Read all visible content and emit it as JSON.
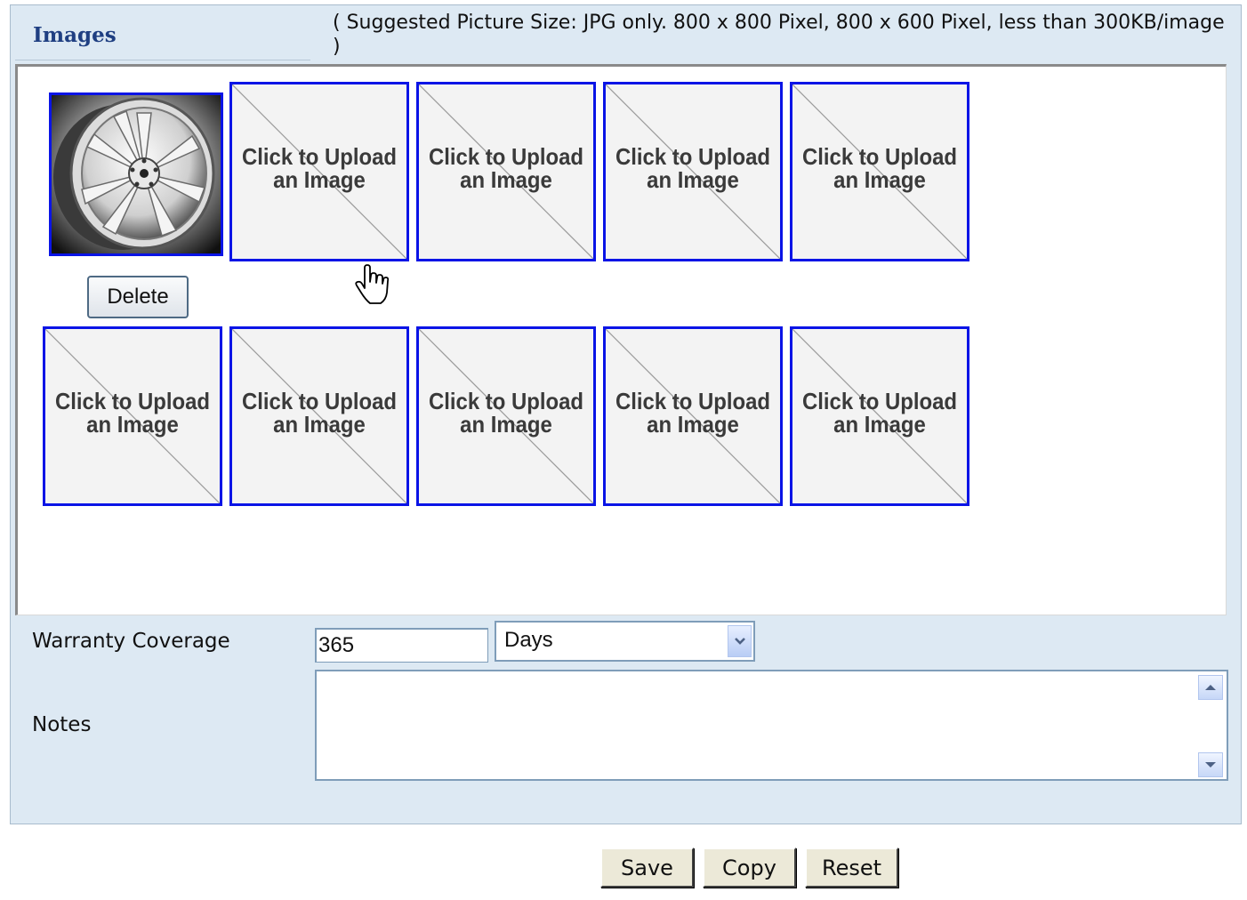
{
  "images_section": {
    "title": "Images",
    "suggestion": "( Suggested Picture Size: JPG only. 800 x 800 Pixel, 800 x 600 Pixel, less than 300KB/image )",
    "upload_tile_label": "Click to Upload an Image",
    "delete_label": "Delete",
    "uploaded_count": 1,
    "empty_slots": 9
  },
  "warranty": {
    "label": "Warranty Coverage",
    "value": "365",
    "unit_selected": "Days"
  },
  "notes": {
    "label": "Notes",
    "value": ""
  },
  "actions": {
    "save": "Save",
    "copy": "Copy",
    "reset": "Reset"
  },
  "colors": {
    "tile_border": "#0a14e6",
    "panel_bg": "#dde9f3",
    "title_color": "#1f3f82"
  }
}
